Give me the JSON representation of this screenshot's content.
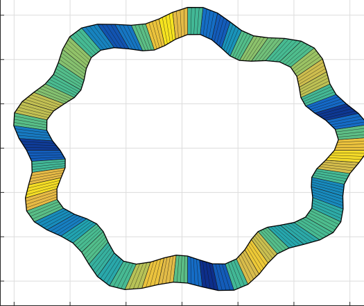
{
  "chart_data": {
    "type": "surface",
    "title": "",
    "xlabel": "",
    "ylabel": "",
    "xlim": [
      0,
      7
    ],
    "ylim": [
      0,
      7
    ],
    "x_ticks": [
      0.5,
      1.5,
      2.5,
      3.5,
      4.5,
      5.5,
      6.5
    ],
    "y_ticks": [
      0.5,
      1.5,
      2.5,
      3.5,
      4.5,
      5.5,
      6.5
    ],
    "tick_labels_visible": false,
    "grid": true,
    "colormap": "parula",
    "colormap_colors": [
      "#0d2f8a",
      "#1569c7",
      "#1a9fb7",
      "#4bbd8f",
      "#a9c45c",
      "#e8ba45",
      "#f6e31f"
    ],
    "surface": {
      "shape": "wavy closed ring (torus-like band) seen from above",
      "center": [
        3.6,
        3.45
      ],
      "inner_radius": 2.45,
      "outer_radius": 3.05,
      "waviness_amplitude": 0.18,
      "wave_count": 9,
      "segments": 72,
      "color_value_range": [
        -1,
        1
      ]
    }
  }
}
